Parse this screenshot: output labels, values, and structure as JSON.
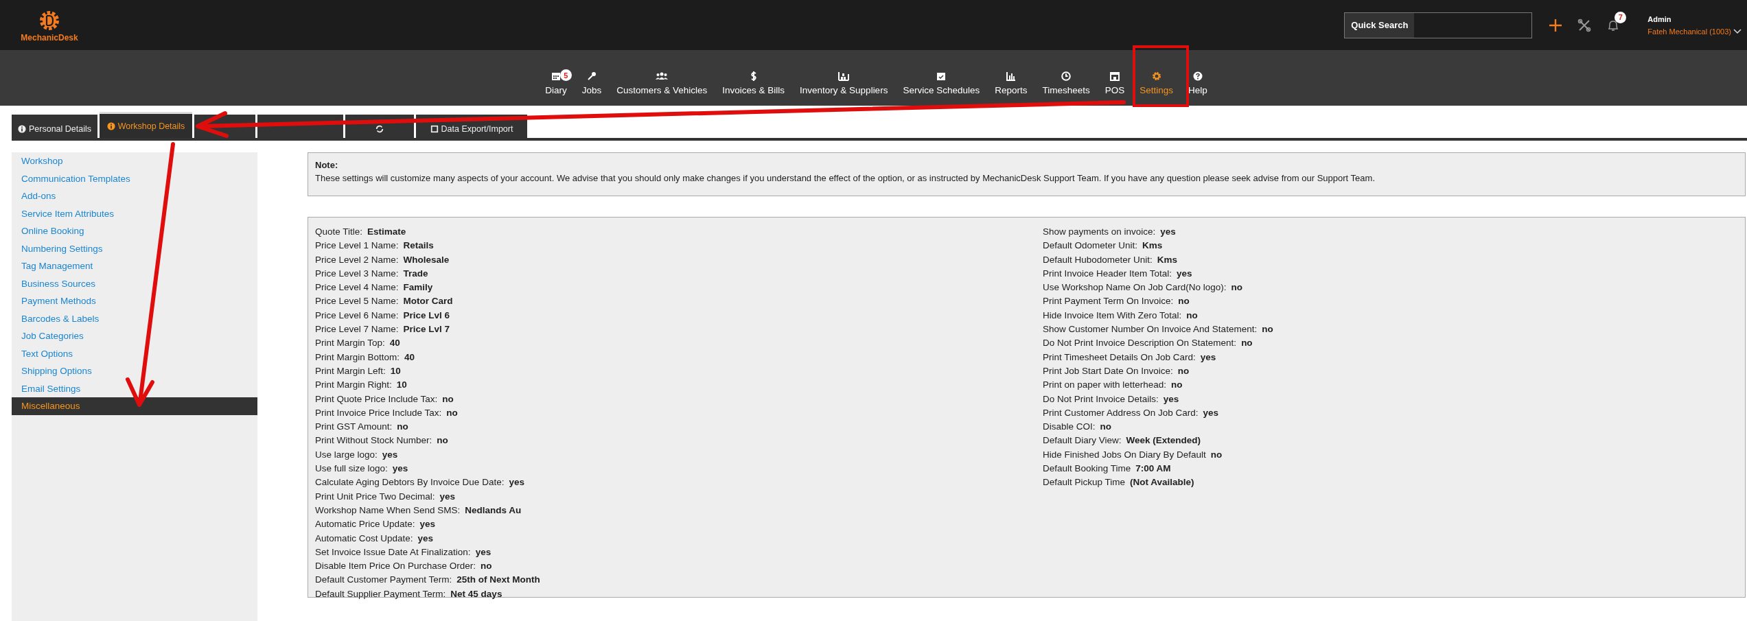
{
  "header": {
    "logo_text": "MechanicDesk",
    "quick_search": {
      "label": "Quick Search"
    },
    "notifications_badge": "7",
    "user": {
      "name": "Admin",
      "company": "Fateh Mechanical (1003)"
    }
  },
  "nav": [
    {
      "label": "Diary",
      "badge": "5",
      "selected": false
    },
    {
      "label": "Jobs",
      "selected": false
    },
    {
      "label": "Customers & Vehicles",
      "selected": false
    },
    {
      "label": "Invoices & Bills",
      "selected": false
    },
    {
      "label": "Inventory & Suppliers",
      "selected": false
    },
    {
      "label": "Service Schedules",
      "selected": false
    },
    {
      "label": "Reports",
      "selected": false
    },
    {
      "label": "Timesheets",
      "selected": false
    },
    {
      "label": "POS",
      "selected": false
    },
    {
      "label": "Settings",
      "selected": true
    },
    {
      "label": "Help",
      "selected": false
    }
  ],
  "tabs": [
    {
      "label": "Personal Details",
      "selected": false
    },
    {
      "label": "Workshop Details",
      "selected": true
    },
    {
      "selected": false
    },
    {
      "selected": false
    },
    {
      "selected": false
    },
    {
      "label": "Data Export/Import",
      "selected": false
    }
  ],
  "sidebar": {
    "items": [
      {
        "label": "Workshop",
        "selected": false
      },
      {
        "label": "Communication Templates",
        "selected": false
      },
      {
        "label": "Add-ons",
        "selected": false
      },
      {
        "label": "Service Item Attributes",
        "selected": false
      },
      {
        "label": "Online Booking",
        "selected": false
      },
      {
        "label": "Numbering Settings",
        "selected": false
      },
      {
        "label": "Tag Management",
        "selected": false
      },
      {
        "label": "Business Sources",
        "selected": false
      },
      {
        "label": "Payment Methods",
        "selected": false
      },
      {
        "label": "Barcodes & Labels",
        "selected": false
      },
      {
        "label": "Job Categories",
        "selected": false
      },
      {
        "label": "Text Options",
        "selected": false
      },
      {
        "label": "Shipping Options",
        "selected": false
      },
      {
        "label": "Email Settings",
        "selected": false
      },
      {
        "label": "Miscellaneous",
        "selected": true
      }
    ]
  },
  "note": {
    "title": "Note:",
    "text": "These settings will customize many aspects of your account. We advise that you should only make changes if you understand the effect of the option, or as instructed by MechanicDesk Support Team. If you have any question please seek advise from our Support Team."
  },
  "settings": {
    "columns": [
      [
        {
          "label": "Quote Title:",
          "value": "Estimate"
        },
        {
          "label": "Price Level 1 Name:",
          "value": "Retails"
        },
        {
          "label": "Price Level 2 Name:",
          "value": "Wholesale"
        },
        {
          "label": "Price Level 3 Name:",
          "value": "Trade"
        },
        {
          "label": "Price Level 4 Name:",
          "value": "Family"
        },
        {
          "label": "Price Level 5 Name:",
          "value": "Motor Card"
        },
        {
          "label": "Price Level 6 Name:",
          "value": "Price Lvl 6"
        },
        {
          "label": "Price Level 7 Name:",
          "value": "Price Lvl 7"
        },
        {
          "label": "Print Margin Top:",
          "value": "40"
        },
        {
          "label": "Print Margin Bottom:",
          "value": "40"
        },
        {
          "label": "Print Margin Left:",
          "value": "10"
        },
        {
          "label": "Print Margin Right:",
          "value": "10"
        },
        {
          "label": "Print Quote Price Include Tax:",
          "value": "no"
        },
        {
          "label": "Print Invoice Price Include Tax:",
          "value": "no"
        },
        {
          "label": "Print GST Amount:",
          "value": "no"
        },
        {
          "label": "Print Without Stock Number:",
          "value": "no"
        },
        {
          "label": "Use large logo:",
          "value": "yes"
        },
        {
          "label": "Use full size logo:",
          "value": "yes"
        },
        {
          "label": "Calculate Aging Debtors By Invoice Due Date:",
          "value": "yes"
        },
        {
          "label": "Print Unit Price Two Decimal:",
          "value": "yes"
        },
        {
          "label": "Workshop Name When Send SMS:",
          "value": "Nedlands Au"
        },
        {
          "label": "Automatic Price Update:",
          "value": "yes"
        },
        {
          "label": "Automatic Cost Update:",
          "value": "yes"
        },
        {
          "label": "Set Invoice Issue Date At Finalization:",
          "value": "yes"
        },
        {
          "label": "Disable Item Price On Purchase Order:",
          "value": "no"
        },
        {
          "label": "Default Customer Payment Term:",
          "value": "25th of Next Month"
        },
        {
          "label": "Default Supplier Payment Term:",
          "value": "Net 45 days"
        }
      ],
      [
        {
          "label": "Show payments on invoice:",
          "value": "yes"
        },
        {
          "label": "Default Odometer Unit:",
          "value": "Kms"
        },
        {
          "label": "Default Hubodometer Unit:",
          "value": "Kms"
        },
        {
          "label": "Print Invoice Header Item Total:",
          "value": "yes"
        },
        {
          "label": "Use Workshop Name On Job Card(No logo):",
          "value": "no"
        },
        {
          "label": "Print Payment Term On Invoice:",
          "value": "no"
        },
        {
          "label": "Hide Invoice Item With Zero Total:",
          "value": "no"
        },
        {
          "label": "Show Customer Number On Invoice And Statement:",
          "value": "no"
        },
        {
          "label": "Do Not Print Invoice Description On Statement:",
          "value": "no"
        },
        {
          "label": "Print Timesheet Details On Job Card:",
          "value": "yes"
        },
        {
          "label": "Print Job Start Date On Invoice:",
          "value": "no"
        },
        {
          "label": "Print on paper with letterhead:",
          "value": "no"
        },
        {
          "label": "Do Not Print Invoice Details:",
          "value": "yes"
        },
        {
          "label": "Print Customer Address On Job Card:",
          "value": "yes"
        },
        {
          "label": "Disable COI:",
          "value": "no"
        },
        {
          "label": "Default Diary View:",
          "value": "Week (Extended)"
        },
        {
          "label": "Hide Finished Jobs On Diary By Default",
          "value": "no"
        },
        {
          "label": "Default Booking Time",
          "value": "7:00 AM"
        },
        {
          "label": "Default Pickup Time",
          "value": "(Not Available)"
        }
      ]
    ]
  },
  "annotations": [
    {
      "kind": "arrow"
    },
    {
      "kind": "arrow"
    },
    {
      "kind": "box"
    }
  ]
}
